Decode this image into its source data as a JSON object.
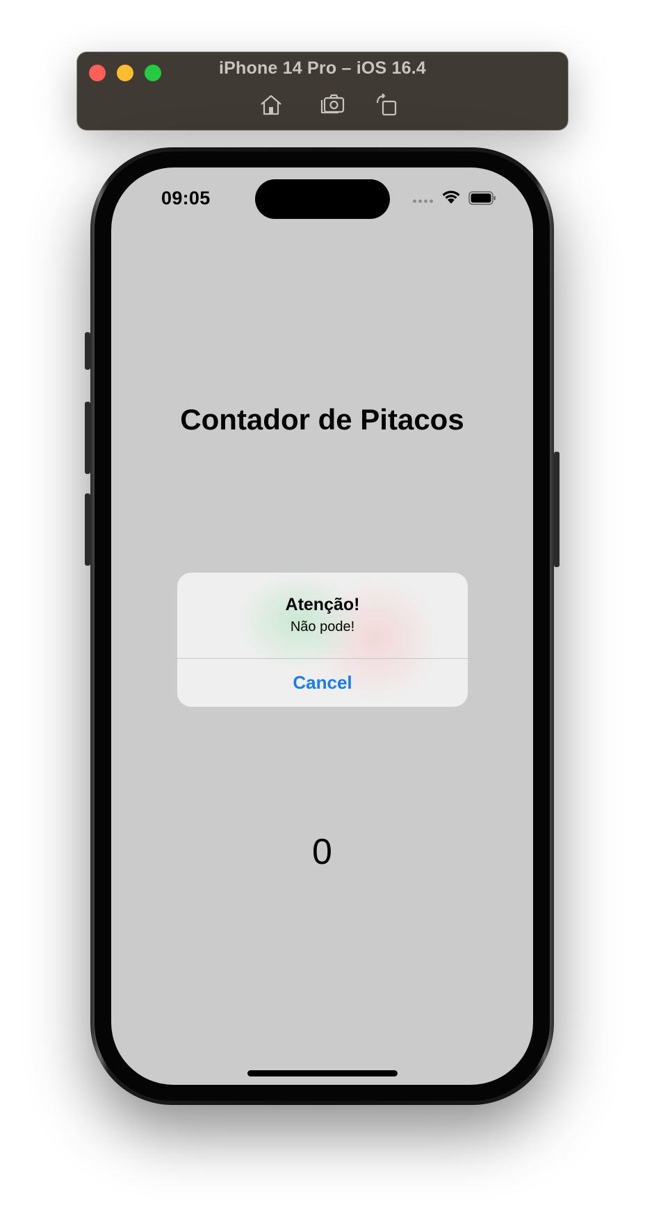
{
  "simulator": {
    "title": "iPhone 14 Pro – iOS 16.4",
    "icons": [
      "home-icon",
      "screenshot-icon",
      "rotate-icon"
    ]
  },
  "status_bar": {
    "time": "09:05",
    "icons": [
      "signal-icon",
      "wifi-icon",
      "battery-icon"
    ]
  },
  "app": {
    "title": "Contador de Pitacos",
    "counter": "0"
  },
  "alert": {
    "title": "Atenção!",
    "message": "Não pode!",
    "cancel_label": "Cancel"
  },
  "colors": {
    "screen_background": "#cbcbcb",
    "alert_button": "#1a7cf0",
    "titlebar": "#403a34"
  }
}
